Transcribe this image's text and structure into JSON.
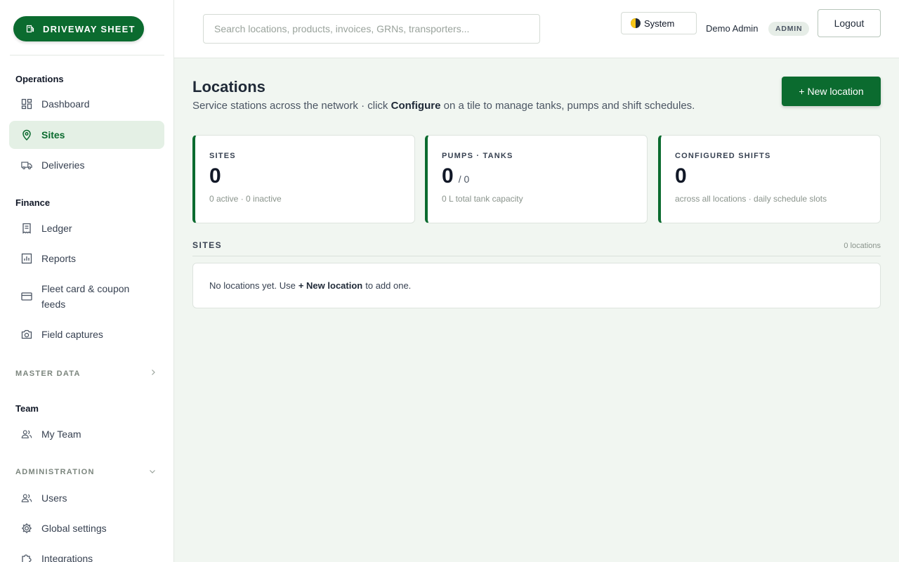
{
  "brand": {
    "label": "DRIVEWAY SHEET",
    "color": "#0b6b2f"
  },
  "sidebar": {
    "operations": {
      "title": "Operations",
      "items": [
        {
          "label": "Dashboard",
          "icon": "dashboard-icon"
        },
        {
          "label": "Sites",
          "icon": "map-pin-icon",
          "active": true
        },
        {
          "label": "Deliveries",
          "icon": "truck-icon"
        }
      ]
    },
    "finance": {
      "title": "Finance",
      "items": [
        {
          "label": "Ledger",
          "icon": "receipt-icon"
        },
        {
          "label": "Reports",
          "icon": "bar-chart-icon"
        },
        {
          "label": "Fleet card & coupon feeds",
          "icon": "credit-card-icon"
        },
        {
          "label": "Field captures",
          "icon": "camera-icon"
        }
      ]
    },
    "master_data": {
      "title": "MASTER DATA",
      "icon": "chevron-right-icon"
    },
    "team": {
      "title": "Team",
      "items": [
        {
          "label": "My Team",
          "icon": "users-icon"
        }
      ]
    },
    "administration": {
      "title": "ADMINISTRATION",
      "icon": "chevron-down-icon",
      "items": [
        {
          "label": "Users",
          "icon": "users-icon"
        },
        {
          "label": "Global settings",
          "icon": "gear-icon"
        },
        {
          "label": "Integrations",
          "icon": "puzzle-icon"
        }
      ]
    }
  },
  "topbar": {
    "search_placeholder": "Search locations, products, invoices, GRNs, transporters...",
    "theme_label": "System",
    "user_name": "Demo Admin",
    "role": "ADMIN",
    "logout_label": "Logout"
  },
  "page": {
    "title": "Locations",
    "subtitle_before": "Service stations across the network · click",
    "subtitle_bold": "Configure",
    "subtitle_after": "on a tile to manage tanks, pumps and shift schedules.",
    "new_button": "+ New location"
  },
  "stats": [
    {
      "label": "SITES",
      "value": "0",
      "sub": "",
      "hint": "0 active · 0 inactive"
    },
    {
      "label": "PUMPS · TANKS",
      "value": "0",
      "sub": "/ 0",
      "hint": "0 L total tank capacity"
    },
    {
      "label": "CONFIGURED SHIFTS",
      "value": "0",
      "sub": "",
      "hint": "across all locations · daily schedule slots"
    }
  ],
  "list": {
    "title": "SITES",
    "count": "0 locations",
    "empty_before": "No locations yet. Use",
    "empty_bold": "+ New location",
    "empty_after": "to add one."
  }
}
